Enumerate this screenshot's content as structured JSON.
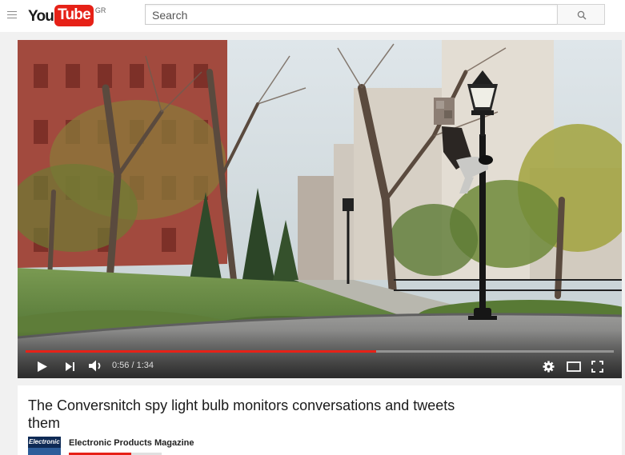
{
  "masthead": {
    "logo_you": "You",
    "logo_tube": "Tube",
    "logo_country": "GR",
    "search_placeholder": "Search"
  },
  "player": {
    "current_time": "0:56",
    "duration": "1:34",
    "time_separator": " / ",
    "progress_fraction": 0.596,
    "accent_color": "#e62117"
  },
  "video": {
    "title": "The Conversnitch spy light bulb monitors conversations and tweets them",
    "channel_name": "Electronic Products Magazine",
    "channel_thumb_text": "Electronic"
  },
  "icons": [
    "menu-icon",
    "search-icon",
    "play-icon",
    "next-icon",
    "volume-icon",
    "settings-icon",
    "theater-mode-icon",
    "fullscreen-icon"
  ]
}
